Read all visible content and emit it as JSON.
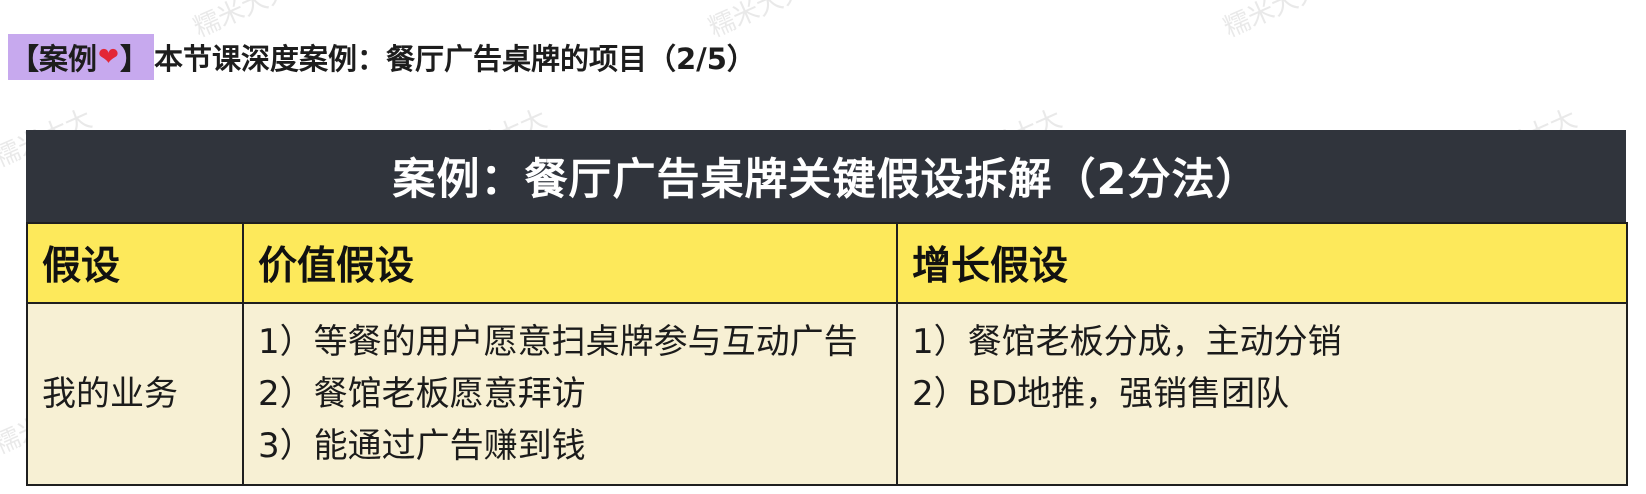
{
  "header": {
    "tag_prefix": "【案例",
    "tag_suffix": "】",
    "heart_icon": "❤",
    "title": "本节课深度案例：餐厅广告桌牌的项目（2/5）"
  },
  "table": {
    "banner": "案例：餐厅广告桌牌关键假设拆解（2分法）",
    "headers": [
      "假设",
      "价值假设",
      "增长假设"
    ],
    "row": {
      "label": "我的业务",
      "value_assumptions": [
        "1）等餐的用户愿意扫桌牌参与互动广告",
        "2）餐馆老板愿意拜访",
        "3）能通过广告赚到钱"
      ],
      "growth_assumptions": [
        "1）餐馆老板分成，主动分销",
        "2）BD地推，强销售团队"
      ]
    }
  },
  "watermark_text": "糯米大大",
  "colors": {
    "tag_bg": "#c7a9ee",
    "banner_bg": "#30343c",
    "header_bg": "#fde95b",
    "cell_bg": "#f7f0d4",
    "border": "#1f1f1f"
  }
}
